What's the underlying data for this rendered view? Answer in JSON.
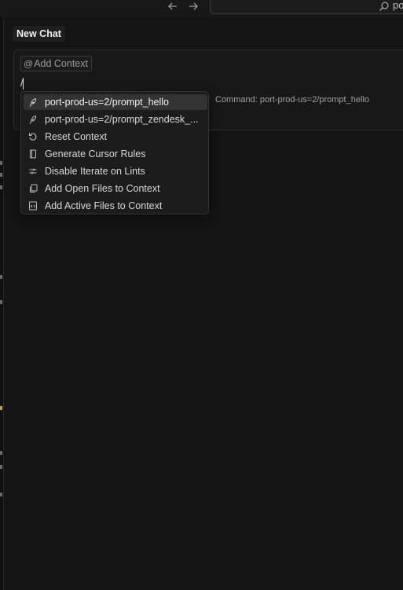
{
  "search": {
    "text": "po"
  },
  "header": {
    "new_chat_label": "New Chat"
  },
  "composer": {
    "add_context_label": "Add Context",
    "input_value": "/"
  },
  "menu": {
    "items": [
      {
        "label": "port-prod-us=2/prompt_hello",
        "icon": "feather-icon",
        "selected": true
      },
      {
        "label": "port-prod-us=2/prompt_zendesk_...",
        "icon": "feather-icon",
        "selected": false
      },
      {
        "label": "Reset Context",
        "icon": "refresh-icon",
        "selected": false
      },
      {
        "label": "Generate Cursor Rules",
        "icon": "book-icon",
        "selected": false
      },
      {
        "label": "Disable Iterate on Lints",
        "icon": "sliders-icon",
        "selected": false
      },
      {
        "label": "Add Open Files to Context",
        "icon": "copy-files-icon",
        "selected": false
      },
      {
        "label": "Add Active Files to Context",
        "icon": "code-file-icon",
        "selected": false
      }
    ]
  },
  "command_hint": "Command: port-prod-us=2/prompt_hello"
}
